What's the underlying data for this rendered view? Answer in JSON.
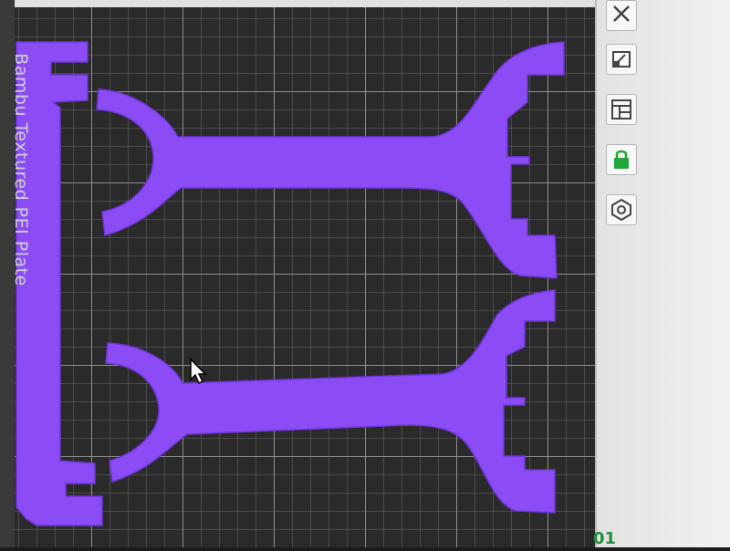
{
  "app": {
    "plate_label": "Bambu Textured PEI Plate",
    "counter_text": "01"
  },
  "colors": {
    "part": "#8b4cf6",
    "part_edge": "#6f35d8",
    "bed": "#2a2a2a",
    "grid_minor": "#6a6a6a",
    "grid_major": "#8e8e8e",
    "panel": "#efefef",
    "lock_green": "#22a53a"
  },
  "toolbar": {
    "buttons": [
      {
        "id": "close",
        "icon": "close-icon"
      },
      {
        "id": "arrange",
        "icon": "arrange-icon"
      },
      {
        "id": "layout",
        "icon": "layout-icon"
      },
      {
        "id": "lock",
        "icon": "lock-icon"
      },
      {
        "id": "settings",
        "icon": "hex-nut-icon"
      }
    ]
  },
  "scene": {
    "objects": [
      {
        "name": "vertical-bar"
      },
      {
        "name": "stand-arm-top"
      },
      {
        "name": "stand-arm-bottom"
      }
    ]
  }
}
